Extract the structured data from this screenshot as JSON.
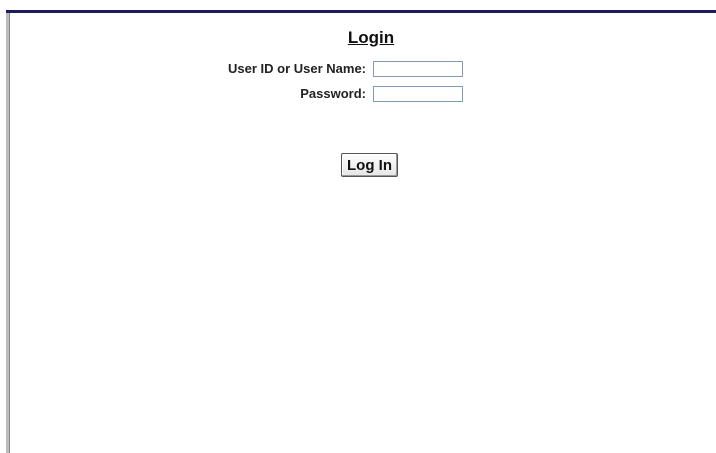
{
  "login": {
    "title": "Login",
    "user_label": "User ID or User Name:",
    "password_label": "Password:",
    "user_value": "",
    "password_value": "",
    "button_label": "Log In"
  },
  "colors": {
    "top_bar": "#1c1c5a",
    "left_border": "#bcbcbc",
    "input_border": "#7f9db9"
  }
}
